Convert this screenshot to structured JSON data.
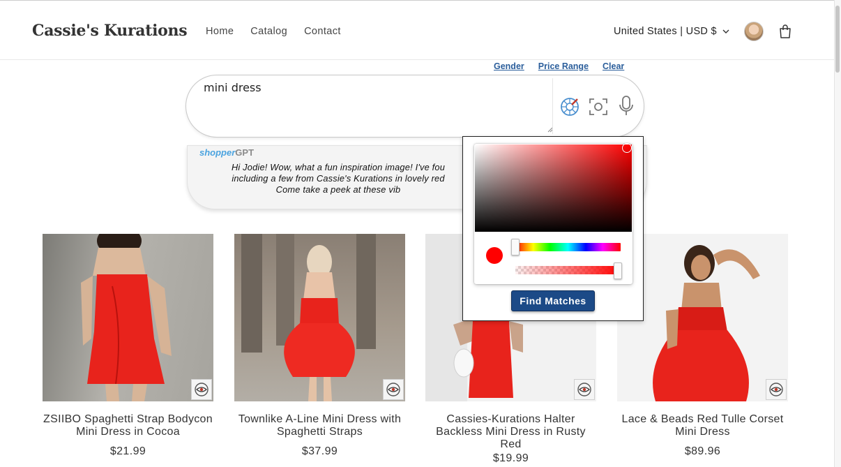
{
  "header": {
    "brand": "Cassie's Kurations",
    "nav": [
      "Home",
      "Catalog",
      "Contact"
    ],
    "locale": "United States | USD $"
  },
  "search": {
    "query": "mini dress",
    "filters": [
      "Gender",
      "Price Range",
      "Clear"
    ]
  },
  "assistant": {
    "logo_part1": "shopper",
    "logo_part2": "GPT",
    "message_lines": [
      "Hi Jodie! Wow, what a fun inspiration image! I've fou",
      "including a few from Cassie's Kurations in lovely red",
      "Come take a peek at these vib"
    ]
  },
  "products": [
    {
      "title": "ZSIIBO Spaghetti Strap Bodycon Mini Dress in Cocoa",
      "price": "$21.99"
    },
    {
      "title": "Townlike A-Line Mini Dress with Spaghetti Straps",
      "price": "$37.99"
    },
    {
      "title": "Cassies-Kurations Halter Backless Mini Dress in Rusty Red",
      "price": "$19.99"
    },
    {
      "title": "Lace & Beads Red Tulle Corset Mini Dress",
      "price": "$89.96"
    }
  ],
  "color_picker": {
    "selected_color": "#ff0000",
    "hue": 0,
    "alpha": 1,
    "find_button": "Find Matches"
  },
  "colors": {
    "accent": "#1c4a87",
    "link": "#2b5e9b",
    "dress_red": "#e8231c"
  }
}
